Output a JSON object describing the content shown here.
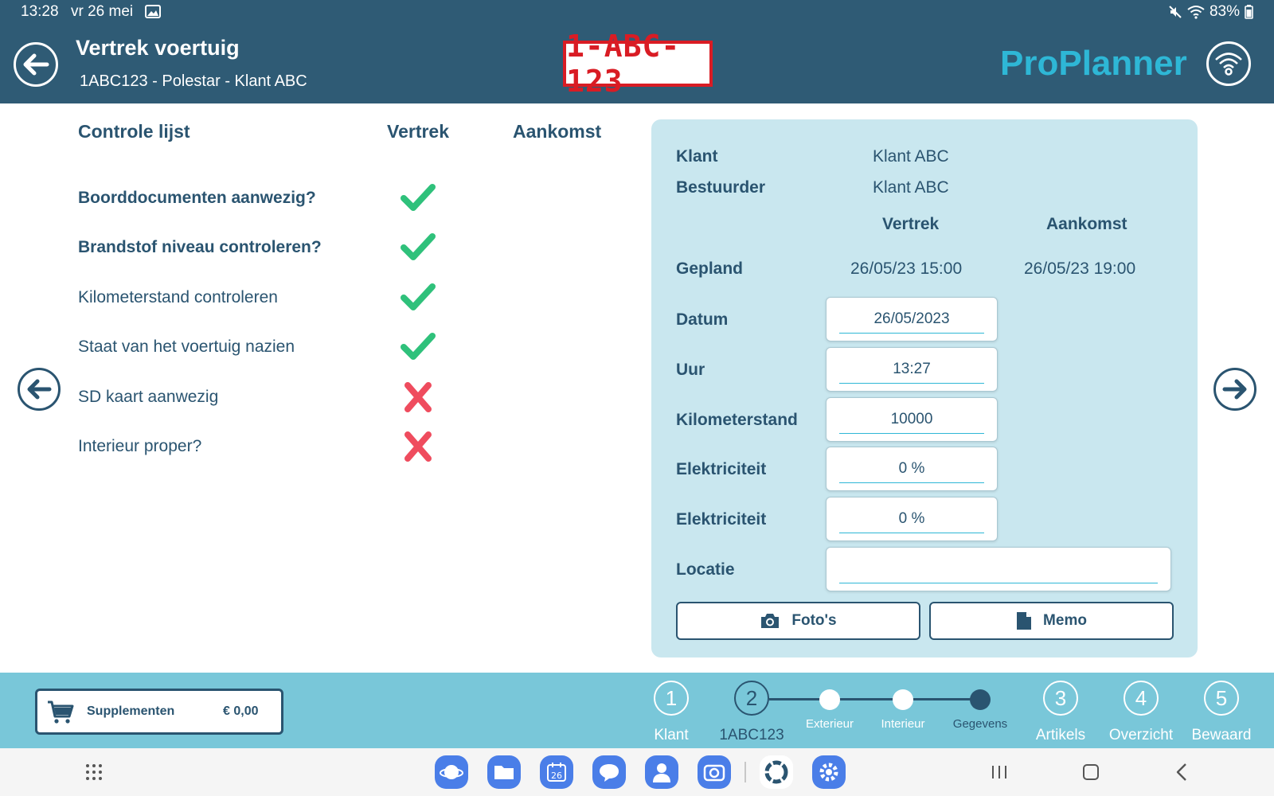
{
  "status_bar": {
    "time": "13:28",
    "date": "vr 26 mei",
    "battery": "83%",
    "icons": [
      "image-icon",
      "mute-icon",
      "wifi-icon",
      "battery-icon"
    ]
  },
  "header": {
    "title": "Vertrek voertuig",
    "subtitle": "1ABC123 -  Polestar - Klant ABC",
    "plate": "1-ABC-123",
    "logo": "ProPlanner"
  },
  "checklist": {
    "title": "Controle lijst",
    "col_departure": "Vertrek",
    "col_arrival": "Aankomst",
    "items": [
      {
        "label": "Boorddocumenten aanwezig?",
        "bold": true,
        "departure": "check"
      },
      {
        "label": "Brandstof niveau controleren?",
        "bold": true,
        "departure": "check"
      },
      {
        "label": "Kilometerstand controleren",
        "bold": false,
        "departure": "check"
      },
      {
        "label": "Staat van het voertuig nazien",
        "bold": false,
        "departure": "check"
      },
      {
        "label": "SD kaart aanwezig",
        "bold": false,
        "departure": "cross"
      },
      {
        "label": "Interieur proper?",
        "bold": false,
        "departure": "cross"
      }
    ]
  },
  "panel": {
    "customer_label": "Klant",
    "customer_value": "Klant ABC",
    "driver_label": "Bestuurder",
    "driver_value": "Klant ABC",
    "col_departure": "Vertrek",
    "col_arrival": "Aankomst",
    "planned_label": "Gepland",
    "planned_departure": "26/05/23 15:00",
    "planned_arrival": "26/05/23 19:00",
    "date_label": "Datum",
    "date_value": "26/05/2023",
    "time_label": "Uur",
    "time_value": "13:27",
    "mileage_label": "Kilometerstand",
    "mileage_value": "10000",
    "electricity_label_1": "Elektriciteit",
    "electricity_value_1": "0 %",
    "electricity_label_2": "Elektriciteit",
    "electricity_value_2": "0 %",
    "location_label": "Locatie",
    "location_value": "",
    "photos_button": "Foto's",
    "memo_button": "Memo"
  },
  "bottom": {
    "supplements_label": "Supplementen",
    "supplements_amount": "€ 0,00",
    "steps": [
      {
        "number": "1",
        "label": "Klant",
        "active": false
      },
      {
        "number": "2",
        "label": "1ABC123",
        "active": true
      },
      {
        "number": "3",
        "label": "Artikels",
        "active": false
      },
      {
        "number": "4",
        "label": "Overzicht",
        "active": false
      },
      {
        "number": "5",
        "label": "Bewaard",
        "active": false
      }
    ],
    "substeps": [
      {
        "label": "Exterieur",
        "current": false
      },
      {
        "label": "Interieur",
        "current": false
      },
      {
        "label": "Gegevens",
        "current": true
      }
    ]
  },
  "colors": {
    "header_bg": "#2f5b75",
    "text_dark": "#2a5470",
    "panel_bg": "#c9e7ef",
    "strip_bg": "#79c7d9",
    "check_green": "#2fc17b",
    "cross_red": "#ef4c5e",
    "plate_red": "#d91c24",
    "logo_cyan": "#2eb7d6"
  }
}
